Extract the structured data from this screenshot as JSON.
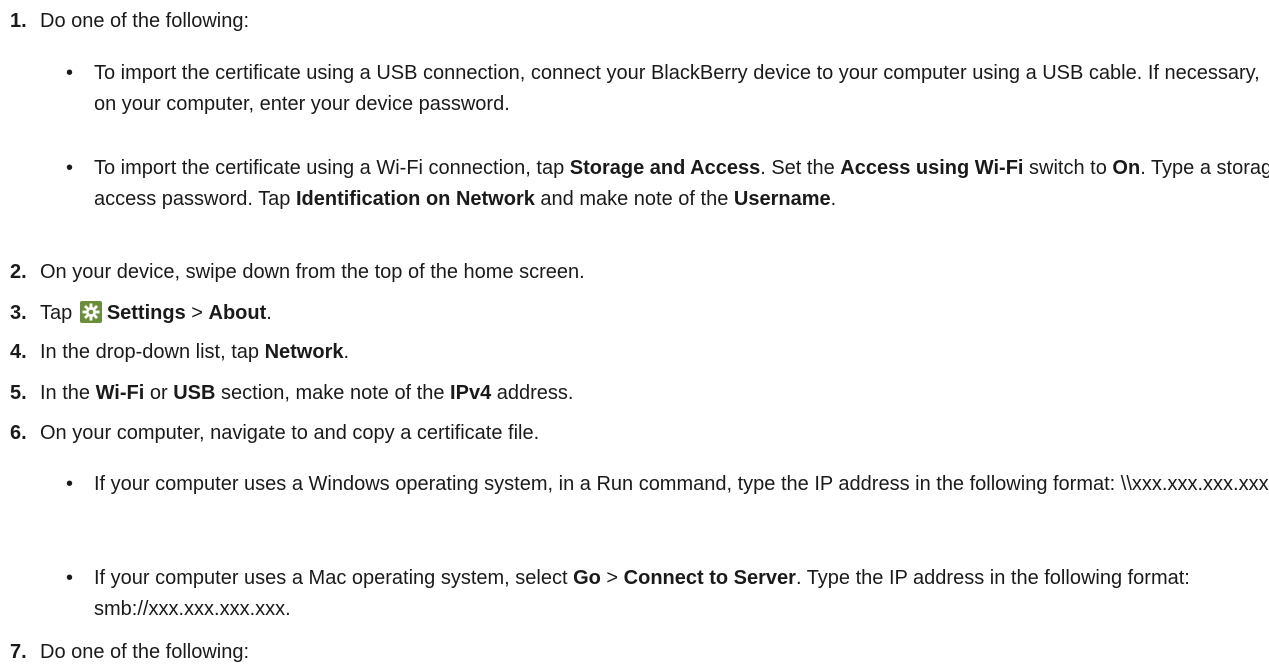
{
  "steps": [
    {
      "num": "1.",
      "text": "Do one of the following:"
    },
    {
      "num": "2.",
      "text": "On your device, swipe down from the top of the home screen."
    },
    {
      "num": "3.",
      "pre": "Tap ",
      "b1": "Settings",
      "mid": " > ",
      "b2": "About",
      "post": "."
    },
    {
      "num": "4.",
      "pre": "In the drop-down list, tap ",
      "b1": "Network",
      "post": "."
    },
    {
      "num": "5.",
      "pre": "In the ",
      "b1": "Wi-Fi",
      "mid1": " or ",
      "b2": "USB",
      "mid2": " section, make note of the ",
      "b3": "IPv4",
      "post": " address."
    },
    {
      "num": "6.",
      "text": "On your computer, navigate to and copy a certificate file."
    },
    {
      "num": "7.",
      "text": "Do one of the following:"
    }
  ],
  "bullets1": [
    {
      "text": "To import the certificate using a USB connection, connect your BlackBerry device to your computer using a USB cable. If necessary, on your computer, enter your device password."
    },
    {
      "p1": "To import the certificate using a Wi-Fi connection, tap ",
      "b1": "Storage and Access",
      "p2": ". Set the ",
      "b2": "Access using Wi-Fi",
      "p3": " switch to ",
      "b3": "On",
      "p4": ". Type a storage access password. Tap ",
      "b4": "Identification on Network",
      "p5": " and make note of the ",
      "b5": "Username",
      "p6": "."
    }
  ],
  "bullets6": [
    {
      "text": "If your computer uses a Windows operating system, in a Run command, type the IP address in the following format: \\\\xxx.xxx.xxx.xxx."
    },
    {
      "p1": "If your computer uses a Mac operating system, select ",
      "b1": "Go",
      "p2": " > ",
      "b2": "Connect to Server",
      "p3": ". Type the IP address in the following format: smb://xxx.xxx.xxx.xxx."
    }
  ],
  "bullet_symbol": "•",
  "icons": {
    "settings": "gear-icon"
  },
  "colors": {
    "settings_icon_bg": "#6b8e3a"
  }
}
